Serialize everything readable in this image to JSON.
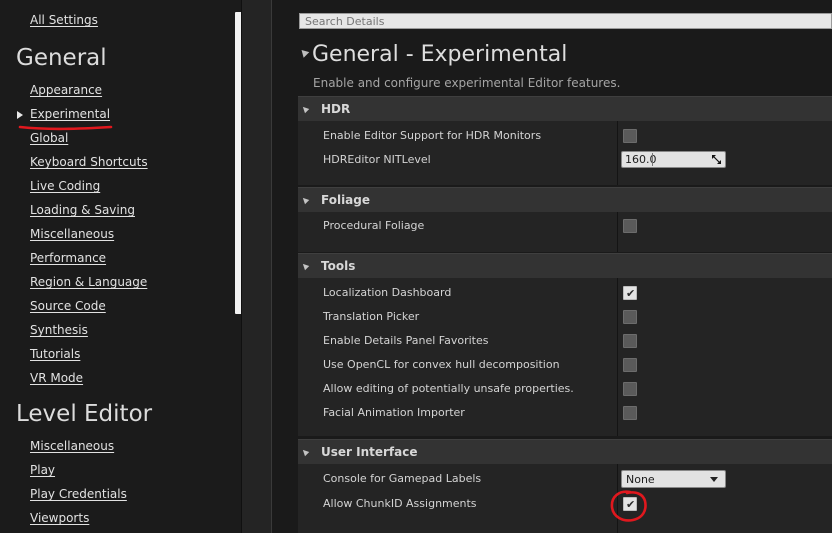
{
  "nav": {
    "all_settings": "All Settings",
    "general_header": "General",
    "general_items": [
      {
        "label": "Appearance"
      },
      {
        "label": "Experimental",
        "selected": true
      },
      {
        "label": "Global"
      },
      {
        "label": "Keyboard Shortcuts"
      },
      {
        "label": "Live Coding"
      },
      {
        "label": "Loading & Saving"
      },
      {
        "label": "Miscellaneous"
      },
      {
        "label": "Performance"
      },
      {
        "label": "Region & Language"
      },
      {
        "label": "Source Code"
      },
      {
        "label": "Synthesis"
      },
      {
        "label": "Tutorials"
      },
      {
        "label": "VR Mode"
      }
    ],
    "level_editor_header": "Level Editor",
    "level_editor_items": [
      {
        "label": "Miscellaneous"
      },
      {
        "label": "Play"
      },
      {
        "label": "Play Credentials"
      },
      {
        "label": "Viewports"
      }
    ]
  },
  "details": {
    "search_placeholder": "Search Details",
    "title": "General - Experimental",
    "description": "Enable and configure experimental Editor features.",
    "categories": [
      {
        "label": "HDR",
        "rows": [
          {
            "label": "Enable Editor Support for HDR Monitors",
            "type": "checkbox",
            "checked": false
          },
          {
            "label": "HDREditor NITLevel",
            "type": "number",
            "value": "160.0"
          }
        ]
      },
      {
        "label": "Foliage",
        "rows": [
          {
            "label": "Procedural Foliage",
            "type": "checkbox",
            "checked": false
          }
        ]
      },
      {
        "label": "Tools",
        "rows": [
          {
            "label": "Localization Dashboard",
            "type": "checkbox",
            "checked": true
          },
          {
            "label": "Translation Picker",
            "type": "checkbox",
            "checked": false
          },
          {
            "label": "Enable Details Panel Favorites",
            "type": "checkbox",
            "checked": false
          },
          {
            "label": "Use OpenCL for convex hull decomposition",
            "type": "checkbox",
            "checked": false
          },
          {
            "label": "Allow editing of potentially unsafe properties.",
            "type": "checkbox",
            "checked": false
          },
          {
            "label": "Facial Animation Importer",
            "type": "checkbox",
            "checked": false
          }
        ]
      },
      {
        "label": "User Interface",
        "rows": [
          {
            "label": "Console for Gamepad Labels",
            "type": "dropdown",
            "value": "None"
          },
          {
            "label": "Allow ChunkID Assignments",
            "type": "checkbox",
            "checked": true
          }
        ]
      }
    ]
  },
  "colors": {
    "annotation_red": "#e0181e",
    "panel_bg": "#242424",
    "header_bg": "#333333"
  },
  "icons": {
    "check": "✔"
  }
}
